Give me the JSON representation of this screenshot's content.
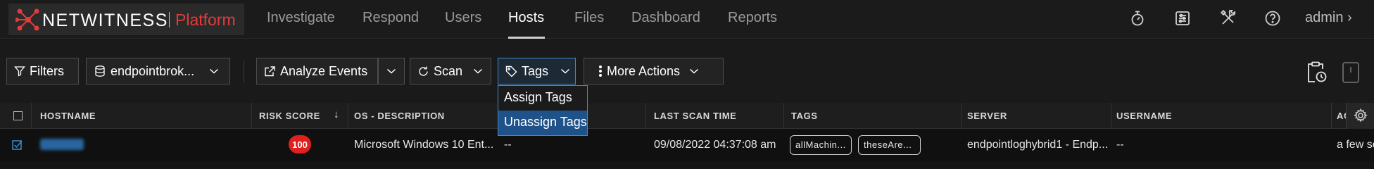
{
  "brand": {
    "name": "NETWITNESS",
    "product": "Platform",
    "accent": "#e23b3b"
  },
  "nav": {
    "items": [
      {
        "label": "Investigate",
        "active": false
      },
      {
        "label": "Respond",
        "active": false
      },
      {
        "label": "Users",
        "active": false
      },
      {
        "label": "Hosts",
        "active": true
      },
      {
        "label": "Files",
        "active": false
      },
      {
        "label": "Dashboard",
        "active": false
      },
      {
        "label": "Reports",
        "active": false
      }
    ],
    "icons": [
      "stopwatch-icon",
      "sliders-icon",
      "tools-icon",
      "help-icon"
    ],
    "user_label": "admin",
    "user_chevron": "›"
  },
  "toolbar": {
    "filters_label": "Filters",
    "service_label": "endpointbrok...",
    "analyze_label": "Analyze Events",
    "scan_label": "Scan",
    "tags_label": "Tags",
    "more_actions_label": "More Actions"
  },
  "tags_menu": {
    "items": [
      {
        "label": "Assign Tags",
        "highlighted": false
      },
      {
        "label": "Unassign Tags",
        "highlighted": true
      }
    ]
  },
  "table": {
    "columns": [
      "HOSTNAME",
      "RISK SCORE",
      "OS - DESCRIPTION",
      "LAST SCAN TIME",
      "TAGS",
      "SERVER",
      "USERNAME",
      "AC"
    ],
    "sort_indicator": "↓",
    "rows": [
      {
        "selected": true,
        "hostname": "",
        "risk_score": "100",
        "os_description": "Microsoft Windows 10 Ent...",
        "extra": "--",
        "last_scan_time": "09/08/2022 04:37:08 am",
        "tags": [
          "allMachin...",
          "theseAre..."
        ],
        "server": "endpointloghybrid1 - Endp...",
        "username": "--",
        "activity": "a few se"
      }
    ]
  },
  "colors": {
    "risk_high": "#e0201e",
    "selection_blue": "#3c8ccf",
    "menu_highlight": "#20528a"
  }
}
